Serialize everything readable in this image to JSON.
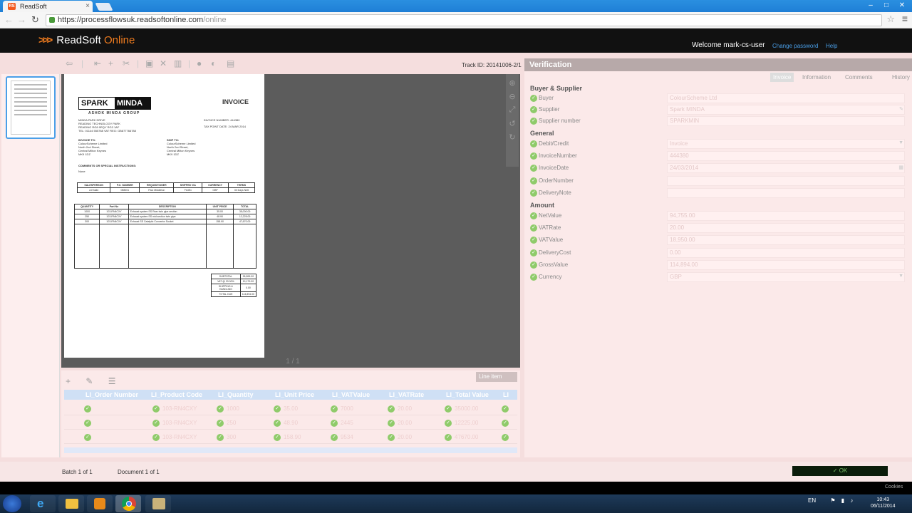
{
  "browser": {
    "tab_title": "ReadSoft",
    "tab_favicon": "RS",
    "url_host": "https://processflowsuk.readsoftonline.com",
    "url_path": "/online"
  },
  "app": {
    "logo_primary": "ReadSoft",
    "logo_secondary": "Online",
    "welcome": "Welcome mark-cs-user",
    "change_password": "Change password",
    "help": "Help",
    "track_id": "Track ID: 20141006-2/1"
  },
  "document": {
    "logo_left": "SPARK",
    "logo_right": "MINDA",
    "logo_sub": "ASHOK MINDA GROUP",
    "title": "INVOICE",
    "meta": [
      {
        "label": "INVOICE NUMBER:",
        "value": "444380"
      },
      {
        "label": "TAX POINT DATE:",
        "value": "24 MAR 2014"
      }
    ],
    "supplier_lines": [
      "MINDA PARK DRIVE",
      "READING TECHNOLOGY PARK",
      "READING RG8 9RQY  RG3 1AF",
      "TEL: 01144 555788  VAT REG: GB877766788"
    ],
    "invoice_to_label": "INVOICE TO:",
    "invoice_to": [
      "ColourScheme Limited",
      "North 2nd Street,",
      "Central Milton Keynes",
      "MK9 1DZ"
    ],
    "ship_to_label": "SHIP TO:",
    "ship_to": [
      "ColourScheme Limited",
      "North 2nd Street,",
      "Central Milton Keynes",
      "MK9 1DZ"
    ],
    "comments_label": "COMMENTS OR SPECIAL INSTRUCTIONS:",
    "comments": "None",
    "sales_headers": [
      "SALESPERSON",
      "P.O. NUMBER",
      "REQUISITIONER",
      "SHIPPED VIA",
      "CURRENCY",
      "TERMS"
    ],
    "sales_values": [
      "A.Khalid",
      "058001",
      "Paul Middleton",
      "FedEx",
      "GBP",
      "30 Days Nett"
    ],
    "item_headers": [
      "QUANTITY",
      "Part No",
      "DESCRIPTION",
      "UNIT PRICE",
      "TOTAL"
    ],
    "items": [
      [
        "1000",
        "103-RN4CXY",
        "Exhaust system SS Rear twin pipe section",
        "35.00",
        "35,000.00"
      ],
      [
        "250",
        "103-RN4CXY",
        "Exhaust system SS mid section twin pipe",
        "48.90",
        "12,225.00"
      ],
      [
        "300",
        "103-RN4CXY",
        "Exhaust SS Catalytic Convertor Socket",
        "158.90",
        "47,670.00"
      ]
    ],
    "totals": [
      {
        "label": "SUBTOTAL",
        "value": "95,895.00"
      },
      {
        "label": "VAT  @ 20.00%",
        "value": "19,179.00"
      },
      {
        "label": "SHIPPING & HANDLING",
        "value": "0.00"
      },
      {
        "label": "TOTAL DUE",
        "value": "114,894.00"
      }
    ]
  },
  "viewer": {
    "pager": "1 / 1"
  },
  "line_items": {
    "badge": "Line item",
    "headers": [
      "LI_Order Number",
      "LI_Product Code",
      "LI_Quantity",
      "LI_Unit Price",
      "LI_VATValue",
      "LI_VATRate",
      "LI_Total Value",
      "LI"
    ],
    "rows": [
      [
        "",
        "103-RN4CXY",
        "1000",
        "35.00",
        "7000",
        "20.00",
        "35000.00"
      ],
      [
        "",
        "103-RN4CXY",
        "250",
        "48.90",
        "2445",
        "20.00",
        "12225.00"
      ],
      [
        "",
        "103-RN4CXY",
        "300",
        "158.90",
        "9534",
        "20.00",
        "47670.00"
      ]
    ]
  },
  "verification": {
    "title": "Verification",
    "tabs": [
      "Invoice",
      "Information",
      "Comments",
      "History"
    ],
    "sections": [
      {
        "name": "Buyer & Supplier",
        "fields": [
          {
            "label": "Buyer",
            "value": "ColourScheme Ltd"
          },
          {
            "label": "Supplier",
            "value": "Spark MINDA"
          },
          {
            "label": "Supplier number",
            "value": "SPARKMIN"
          }
        ]
      },
      {
        "name": "General",
        "fields": [
          {
            "label": "Debit/Credit",
            "value": "Invoice"
          },
          {
            "label": "InvoiceNumber",
            "value": "444380"
          },
          {
            "label": "InvoiceDate",
            "value": "24/03/2014"
          },
          {
            "label": "OrderNumber",
            "value": ""
          },
          {
            "label": "DeliveryNote",
            "value": ""
          }
        ]
      },
      {
        "name": "Amount",
        "fields": [
          {
            "label": "NetValue",
            "value": "94,755.00"
          },
          {
            "label": "VATRate",
            "value": "20.00"
          },
          {
            "label": "VATValue",
            "value": "18,950.00"
          },
          {
            "label": "DeliveryCost",
            "value": "0.00"
          },
          {
            "label": "GrossValue",
            "value": "114,894.00"
          },
          {
            "label": "Currency",
            "value": "GBP"
          }
        ]
      }
    ]
  },
  "status": {
    "batch": "Batch 1 of 1",
    "document": "Document 1 of 1",
    "ok": "OK",
    "cookies": "Cookies"
  },
  "taskbar": {
    "lang": "EN",
    "time": "10:43",
    "date": "06/11/2014"
  }
}
